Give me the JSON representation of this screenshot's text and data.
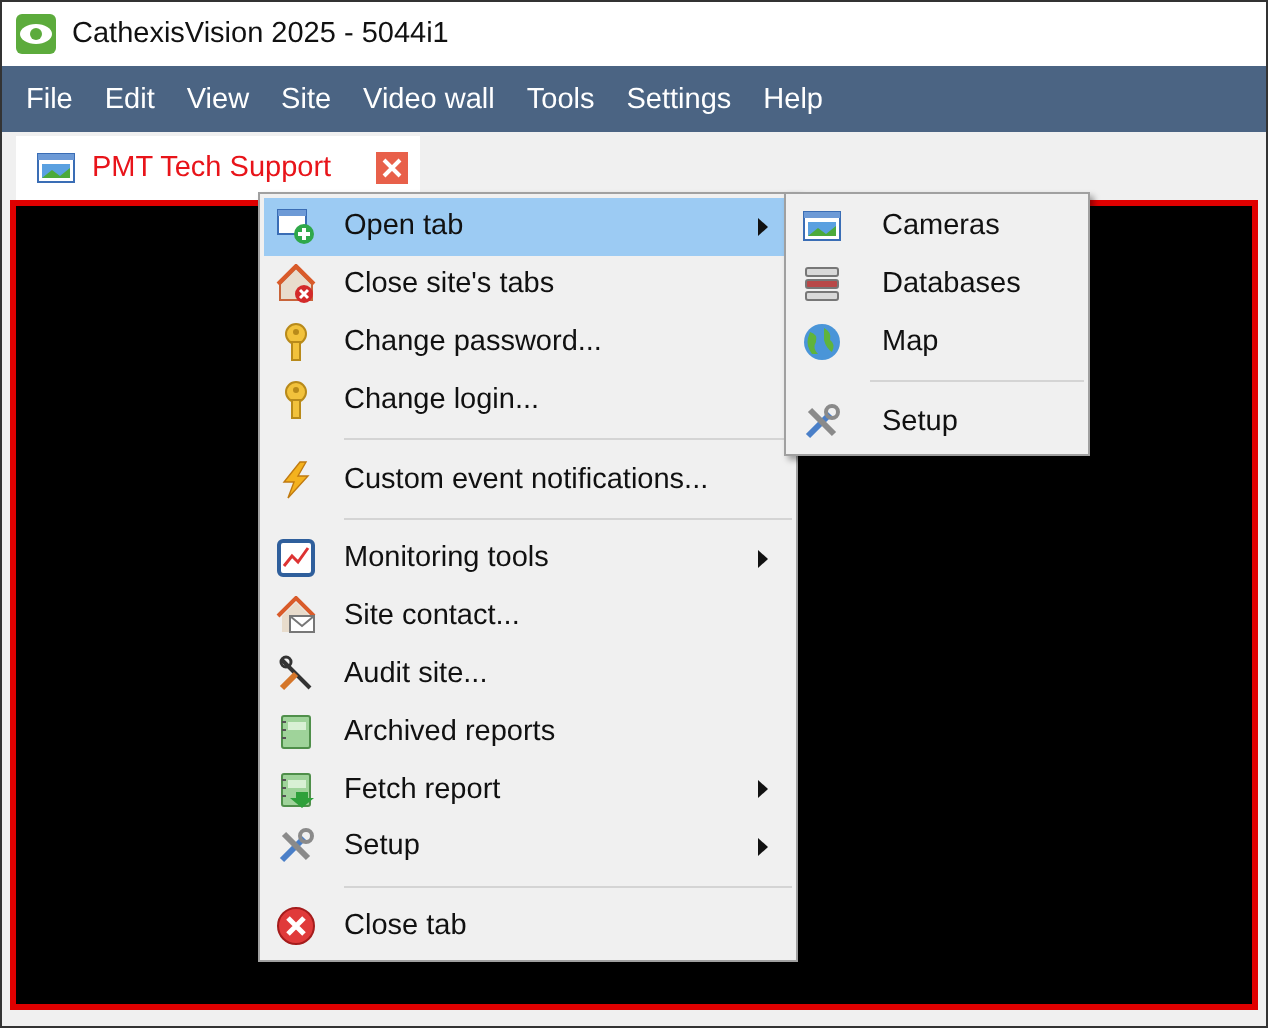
{
  "window": {
    "title": "CathexisVision 2025 - 5044i1"
  },
  "menu_bar": [
    {
      "label": "File"
    },
    {
      "label": "Edit"
    },
    {
      "label": "View"
    },
    {
      "label": "Site"
    },
    {
      "label": "Video wall"
    },
    {
      "label": "Tools"
    },
    {
      "label": "Settings"
    },
    {
      "label": "Help"
    }
  ],
  "tabs": [
    {
      "label": "PMT Tech Support",
      "selected": true
    }
  ],
  "context_menu": {
    "items": [
      {
        "kind": "item",
        "label": "Open tab",
        "has_submenu": true,
        "selected": true
      },
      {
        "kind": "item",
        "label": "Close site's tabs",
        "has_submenu": false,
        "selected": false
      },
      {
        "kind": "item",
        "label": "Change password...",
        "has_submenu": false,
        "selected": false
      },
      {
        "kind": "item",
        "label": "Change login...",
        "has_submenu": false,
        "selected": false
      },
      {
        "kind": "separator"
      },
      {
        "kind": "item",
        "label": "Custom event notifications...",
        "has_submenu": false,
        "selected": false
      },
      {
        "kind": "separator"
      },
      {
        "kind": "item",
        "label": "Monitoring tools",
        "has_submenu": true,
        "selected": false
      },
      {
        "kind": "item",
        "label": "Site contact...",
        "has_submenu": false,
        "selected": false
      },
      {
        "kind": "item",
        "label": "Audit site...",
        "has_submenu": false,
        "selected": false
      },
      {
        "kind": "item",
        "label": "Archived reports",
        "has_submenu": false,
        "selected": false
      },
      {
        "kind": "item",
        "label": "Fetch report",
        "has_submenu": true,
        "selected": false
      },
      {
        "kind": "item",
        "label": "Setup",
        "has_submenu": true,
        "selected": false
      },
      {
        "kind": "separator"
      },
      {
        "kind": "item",
        "label": "Close tab",
        "has_submenu": false,
        "selected": false
      }
    ]
  },
  "submenu": {
    "items": [
      {
        "kind": "item",
        "label": "Cameras",
        "selected": false
      },
      {
        "kind": "item",
        "label": "Databases",
        "selected": false
      },
      {
        "kind": "item",
        "label": "Map",
        "selected": false
      },
      {
        "kind": "separator"
      },
      {
        "kind": "item",
        "label": "Setup",
        "selected": false
      }
    ]
  }
}
